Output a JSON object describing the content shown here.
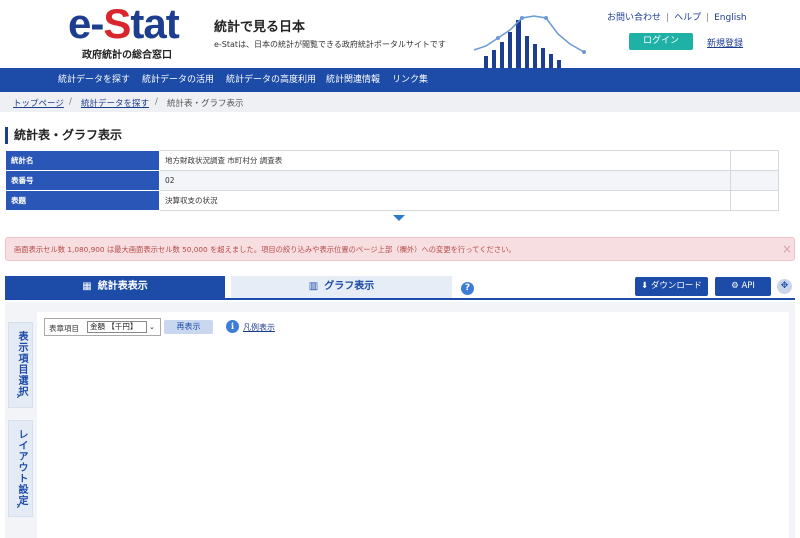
{
  "header": {
    "logo_e": "e-",
    "logo_s": "S",
    "logo_tat": "tat",
    "logo_sub": "政府統計の総合窓口",
    "site_title": "統計で見る日本",
    "site_desc": "e-Statは、日本の統計が閲覧できる政府統計ポータルサイトです",
    "links": [
      "お問い合わせ",
      "ヘルプ",
      "English"
    ],
    "login": "ログイン",
    "register": "新規登録"
  },
  "nav": {
    "items": [
      "統計データを探す",
      "統計データの活用",
      "統計データの高度利用",
      "統計関連情報",
      "リンク集"
    ]
  },
  "breadcrumb": {
    "items": [
      "トップページ",
      "統計データを探す",
      "統計表・グラフ表示"
    ],
    "sep": "/"
  },
  "page_title": "統計表・グラフ表示",
  "info_table": [
    {
      "label": "統計名",
      "value": "地方財政状況調査 市町村分 調査表"
    },
    {
      "label": "表番号",
      "value": "02"
    },
    {
      "label": "表題",
      "value": "決算収支の状況"
    }
  ],
  "alert": {
    "text": "画面表示セル数 1,080,900 は最大画面表示セル数 50,000 を超えました。項目の絞り込みや表示位置のページ上部（欄外）への変更を行ってください。",
    "close": "×"
  },
  "tabs": {
    "table": "統計表表示",
    "graph": "グラフ表示",
    "help": "?",
    "download": "ダウンロード",
    "api": "API"
  },
  "side_tabs": {
    "display_items": "表示項目選択",
    "layout": "レイアウト設定",
    "chevron": "›"
  },
  "controls": {
    "select_label": "表章項目",
    "select_value": "金額 【千円】",
    "redisplay": "再表示",
    "legend_icon": "i",
    "legend_link": "凡例表示"
  },
  "colors": {
    "brand_blue": "#1c4ba8",
    "logo_red": "#d9262c",
    "login_green": "#1fb1a5",
    "alert_bg": "#f7dfe1"
  }
}
